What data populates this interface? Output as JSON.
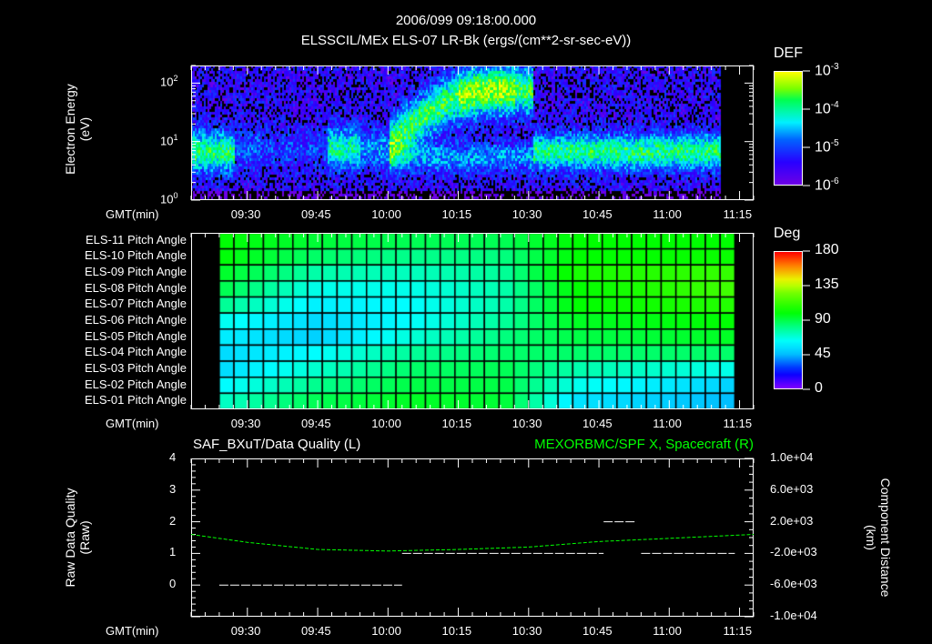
{
  "header": {
    "datetime": "2006/099 09:18:00.000",
    "subtitle": "ELSSCIL/MEx ELS-07 LR-Bk  (ergs/(cm**2-sr-sec-eV))"
  },
  "time_axis": {
    "label": "GMT(min)",
    "ticks": [
      "09:30",
      "09:45",
      "10:00",
      "10:15",
      "10:30",
      "10:45",
      "11:00",
      "11:15"
    ],
    "start_minute": 558,
    "end_minute": 678
  },
  "chart_data": [
    {
      "type": "heatmap",
      "name": "energy-spectrogram",
      "ylabel_line1": "Electron Energy",
      "ylabel_line2": "(eV)",
      "yscale": "log",
      "ylim": [
        1,
        200
      ],
      "yticks": [
        {
          "base": "10",
          "exp": "0",
          "value": 1
        },
        {
          "base": "10",
          "exp": "1",
          "value": 10
        },
        {
          "base": "10",
          "exp": "2",
          "value": 100
        }
      ],
      "data_time_range": [
        "09:18",
        "11:11"
      ],
      "colorbar": {
        "title": "DEF",
        "scale": "log",
        "ticks": [
          {
            "base": "10",
            "exp": "-3"
          },
          {
            "base": "10",
            "exp": "-4"
          },
          {
            "base": "10",
            "exp": "-5"
          },
          {
            "base": "10",
            "exp": "-6"
          }
        ]
      }
    },
    {
      "type": "heatmap",
      "name": "pitch-angle",
      "rows": [
        "ELS-11 Pitch Angle",
        "ELS-10 Pitch Angle",
        "ELS-09 Pitch Angle",
        "ELS-08 Pitch Angle",
        "ELS-07 Pitch Angle",
        "ELS-06 Pitch Angle",
        "ELS-05 Pitch Angle",
        "ELS-04 Pitch Angle",
        "ELS-03 Pitch Angle",
        "ELS-02 Pitch Angle",
        "ELS-01 Pitch Angle"
      ],
      "keyframe_times": [
        "09:24",
        "09:45",
        "10:05",
        "10:25",
        "10:40",
        "11:14"
      ],
      "values_deg": [
        [
          100,
          92,
          88,
          88,
          100,
          100
        ],
        [
          100,
          85,
          80,
          82,
          100,
          102
        ],
        [
          95,
          75,
          72,
          78,
          105,
          112
        ],
        [
          90,
          65,
          65,
          75,
          100,
          115
        ],
        [
          80,
          58,
          62,
          75,
          100,
          108
        ],
        [
          65,
          52,
          62,
          78,
          95,
          100
        ],
        [
          58,
          50,
          68,
          82,
          90,
          95
        ],
        [
          52,
          62,
          78,
          85,
          85,
          85
        ],
        [
          52,
          70,
          85,
          88,
          75,
          65
        ],
        [
          60,
          80,
          90,
          90,
          65,
          50
        ],
        [
          70,
          88,
          95,
          92,
          55,
          45
        ]
      ],
      "columns": 35,
      "colorbar": {
        "title": "Deg",
        "ticks": [
          "180",
          "135",
          "90",
          "45",
          "0"
        ],
        "range": [
          0,
          180
        ]
      }
    },
    {
      "type": "line",
      "name": "quality-and-position",
      "title_left": "SAF_BXuT/Data Quality (L)",
      "title_right": "MEXORBMC/SPF X, Spacecraft (R)",
      "ylabel_left_line1": "Raw Data Quality",
      "ylabel_left_line2": "(Raw)",
      "ylabel_right_line1": "Component Distance",
      "ylabel_right_line2": "(km)",
      "ylim_left": [
        -1,
        4
      ],
      "yticks_left": [
        "4",
        "3",
        "2",
        "1",
        "0"
      ],
      "ylim_right": [
        -10000,
        10000
      ],
      "yticks_right": [
        "1.0e+04",
        "6.0e+03",
        "2.0e+03",
        "-2.0e+03",
        "-6.0e+03",
        "-1.0e+04"
      ],
      "quality_segments": [
        {
          "start": "09:24",
          "end": "10:03",
          "value": 0
        },
        {
          "start": "10:03",
          "end": "10:46",
          "value": 1
        },
        {
          "start": "10:46",
          "end": "10:53",
          "value": 2
        },
        {
          "start": "10:54",
          "end": "11:14",
          "value": 1
        }
      ],
      "position_x_km": {
        "times": [
          "09:18",
          "09:30",
          "09:45",
          "10:00",
          "10:15",
          "10:30",
          "10:45",
          "11:00",
          "11:18"
        ],
        "values": [
          400,
          -600,
          -1500,
          -1700,
          -1500,
          -1200,
          -500,
          -100,
          400
        ]
      },
      "colors": {
        "quality": "#ffffff",
        "position": "#00ff00"
      }
    }
  ]
}
